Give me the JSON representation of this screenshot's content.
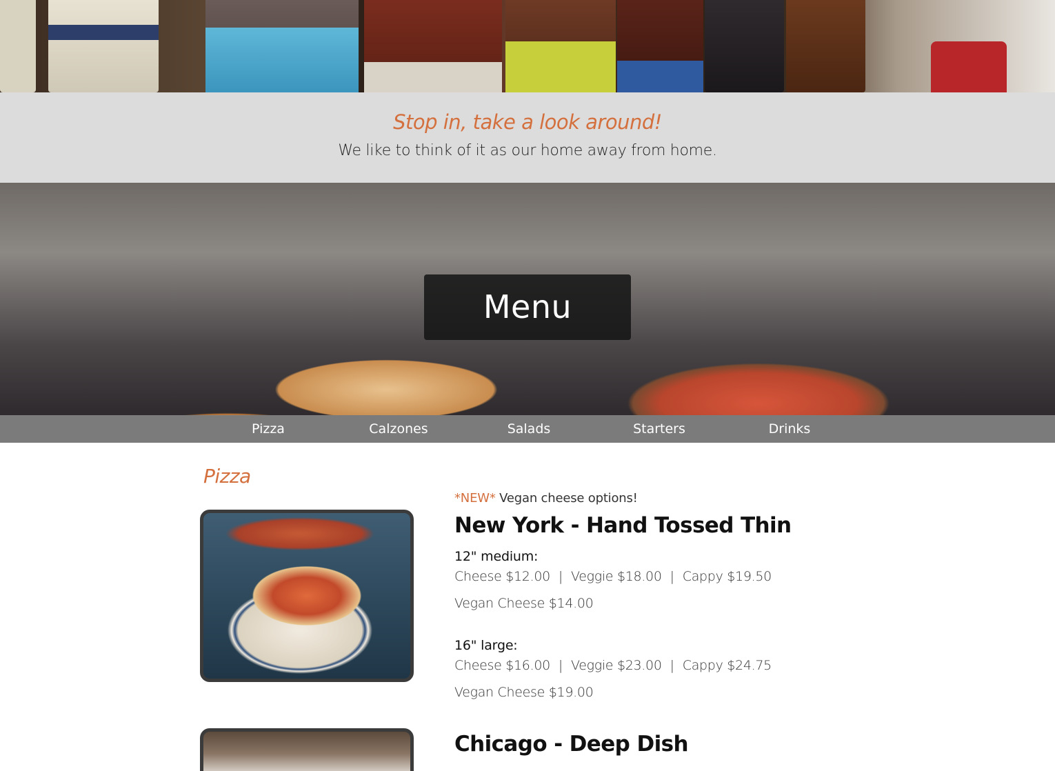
{
  "tagline": {
    "title": "Stop in, take a look around!",
    "subtitle": "We like to think of it as our home away from home."
  },
  "hero": {
    "menu_label": "Menu"
  },
  "nav": {
    "items": [
      {
        "label": "Pizza"
      },
      {
        "label": "Calzones"
      },
      {
        "label": "Salads"
      },
      {
        "label": "Starters"
      },
      {
        "label": "Drinks"
      }
    ]
  },
  "content": {
    "section_title": "Pizza",
    "new_note": {
      "tag": "*NEW*",
      "text": "Vegan cheese options!"
    },
    "items": [
      {
        "title": "New York - Hand Tossed Thin",
        "sizes": [
          {
            "label": "12\" medium:",
            "prices": [
              "Cheese $12.00",
              "Veggie $18.00",
              "Cappy $19.50"
            ],
            "vegan": "Vegan Cheese $14.00"
          },
          {
            "label": "16\" large:",
            "prices": [
              "Cheese $16.00",
              "Veggie $23.00",
              "Cappy $24.75"
            ],
            "vegan": "Vegan Cheese $19.00"
          }
        ]
      },
      {
        "title": "Chicago - Deep Dish"
      }
    ],
    "price_separator": "|"
  },
  "colors": {
    "accent": "#d4703e",
    "band": "#dcdcdc",
    "nav": "#7b7b7b"
  }
}
